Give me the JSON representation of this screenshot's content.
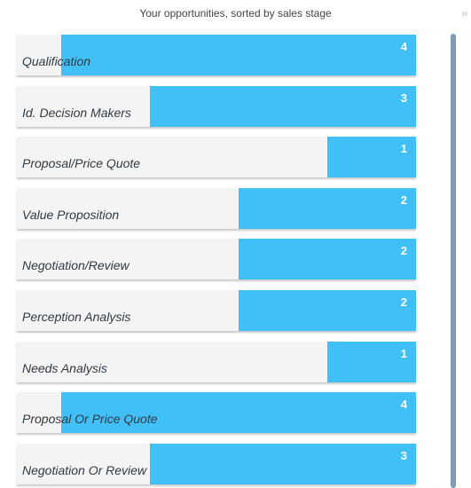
{
  "header": {
    "title": "Your opportunities, sorted by sales stage",
    "expand_icon": "double-chevron-right-icon"
  },
  "colors": {
    "bar": "#40c0f7",
    "row_background": "#f4f4f4",
    "label": "#2f3a44",
    "value": "#ffffff"
  },
  "chart_data": {
    "type": "bar",
    "orientation": "horizontal",
    "categories": [
      "Qualification",
      "Id. Decision Makers",
      "Proposal/Price Quote",
      "Value Proposition",
      "Negotiation/Review",
      "Perception Analysis",
      "Needs Analysis",
      "Proposal Or Price Quote",
      "Negotiation Or Review"
    ],
    "values": [
      4,
      3,
      1,
      2,
      2,
      2,
      1,
      4,
      3
    ],
    "xlim": [
      0,
      4.5
    ],
    "grid": false,
    "legend": "none"
  }
}
